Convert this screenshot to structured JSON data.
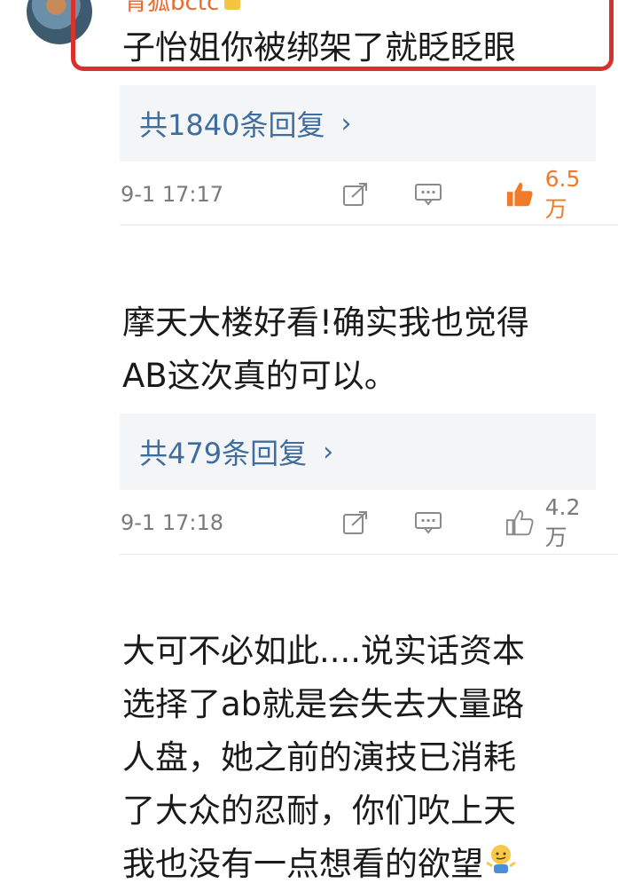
{
  "comments": [
    {
      "username": "青狐bctc",
      "text": "子怡姐你被绑架了就眨眨眼",
      "replies": "共1840条回复",
      "time": "9-1 17:17",
      "likes": "6.5万",
      "liked": true
    },
    {
      "text_lines": [
        "摩天大楼好看!确实我也觉得",
        "AB这次真的可以。"
      ],
      "replies": "共479条回复",
      "time": "9-1 17:18",
      "likes": "4.2万",
      "liked": false
    },
    {
      "text_lines": [
        "大可不必如此....说实话资本",
        "选择了ab就是会失去大量路",
        "人盘，她之前的演技已消耗",
        "了大众的忍耐，你们吹上天",
        "我也没有一点想看的欲望"
      ],
      "emoji": "shrug-emoji"
    }
  ],
  "colors": {
    "liked": "#f07a2a",
    "link": "#3f6e9e",
    "highlight_box": "#d8322f"
  },
  "icons": [
    "repost-icon",
    "comment-icon",
    "thumbs-up-icon",
    "chevron-right-icon"
  ]
}
